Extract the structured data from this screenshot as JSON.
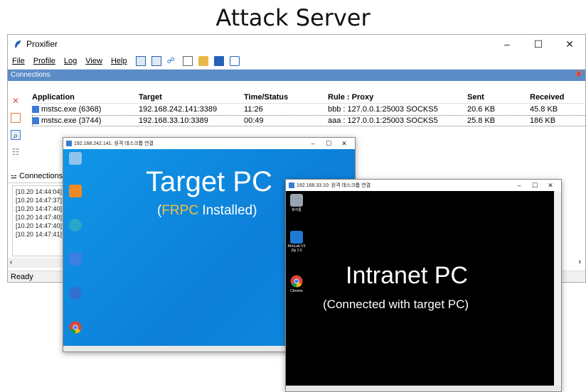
{
  "page_title": "Attack Server",
  "proxifier": {
    "window_title": "Proxifier",
    "window_controls": [
      "–",
      "☐",
      "✕"
    ],
    "menu": [
      "File",
      "Profile",
      "Log",
      "View",
      "Help"
    ],
    "connections_header": "Connections",
    "columns": [
      "Application",
      "Target",
      "Time/Status",
      "Rule : Proxy",
      "Sent",
      "Received"
    ],
    "rows": [
      {
        "application": "mstsc.exe (6368)",
        "target": "192.168.242.141:3389",
        "time": "11:26",
        "rule": "bbb : 127.0.0.1:25003 SOCKS5",
        "sent": "20.6 KB",
        "received": "45.8 KB"
      },
      {
        "application": "mstsc.exe (3744)",
        "target": "192.168.33.10:3389",
        "time": "00:49",
        "rule": "aaa : 127.0.0.1:25003 SOCKS5",
        "sent": "25.8 KB",
        "received": "186 KB"
      }
    ],
    "bottom_tab": "Connections",
    "log_lines": [
      "[10.20 14:44:04]",
      "[10.20 14:47:37]",
      "[10.20 14:47:40]",
      "[10.20 14:47:40]",
      "[10.20 14:47:40]",
      "[10.20 14:47:41]"
    ],
    "status": "Ready"
  },
  "rdp_target": {
    "title": "192.168.242.141: 원격 데스크톱 연결",
    "heading": "Target PC",
    "sub_open": "(",
    "sub_highlight": "FRPC",
    "sub_rest": " Installed)",
    "highlight_color": "#f0c040"
  },
  "rdp_intranet": {
    "title": "192.168.33.10: 원격 데스크톱 연결",
    "heading": "Intranet PC",
    "subheading": "(Connected with target PC)",
    "icon_labels": [
      "휴지통",
      "AhnLab V3 Zip 2.0",
      "Chrome"
    ]
  }
}
